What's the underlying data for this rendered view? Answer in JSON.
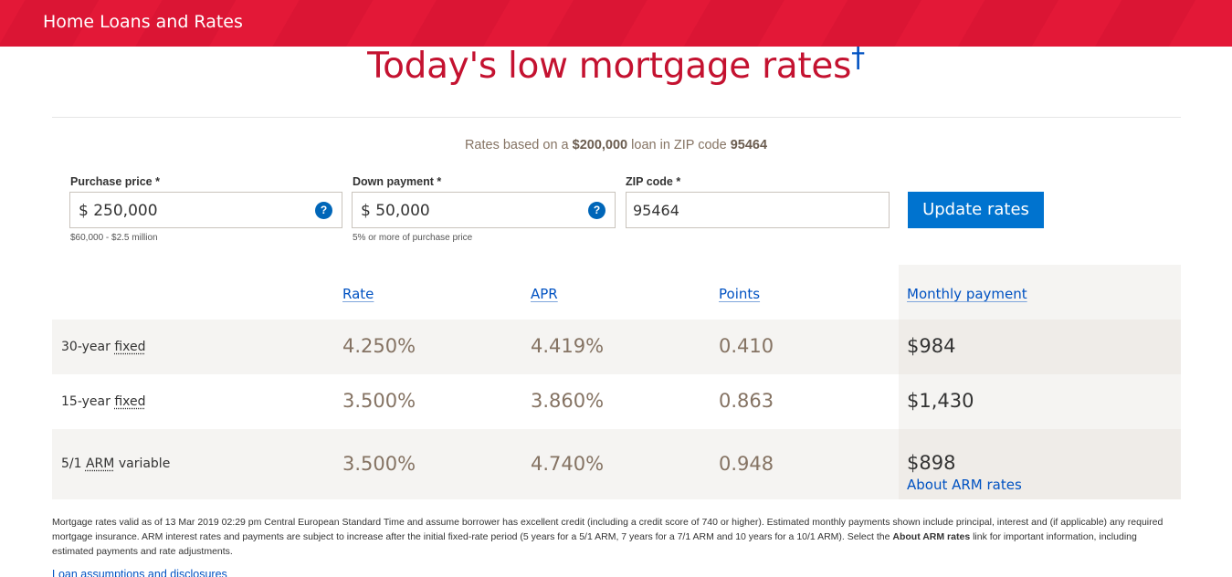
{
  "header": {
    "title": "Home Loans and Rates"
  },
  "hero": {
    "title": "Today's low mortgage rates",
    "dagger": "†"
  },
  "basis": {
    "prefix": "Rates based on a ",
    "loan_amount": "$200,000",
    "middle": " loan in ZIP code ",
    "zip": "95464"
  },
  "form": {
    "purchase_price": {
      "label": "Purchase price *",
      "value": "$ 250,000",
      "hint": "$60,000 - $2.5 million",
      "help": "?"
    },
    "down_payment": {
      "label": "Down payment *",
      "value": "$ 50,000",
      "hint": "5% or more of purchase price",
      "help": "?"
    },
    "zip_code": {
      "label": "ZIP code *",
      "value": "95464"
    },
    "update_label": "Update rates"
  },
  "table": {
    "headers": {
      "rate": "Rate",
      "apr": "APR",
      "points": "Points",
      "monthly": "Monthly payment"
    },
    "rows": [
      {
        "term_prefix": "30-year ",
        "term_link": "fixed",
        "term_suffix": "",
        "rate": "4.250%",
        "apr": "4.419%",
        "points": "0.410",
        "payment": "$984"
      },
      {
        "term_prefix": "15-year ",
        "term_link": "fixed",
        "term_suffix": "",
        "rate": "3.500%",
        "apr": "3.860%",
        "points": "0.863",
        "payment": "$1,430"
      },
      {
        "term_prefix": "5/1 ",
        "term_link": "ARM",
        "term_suffix": " variable",
        "rate": "3.500%",
        "apr": "4.740%",
        "points": "0.948",
        "payment": "$898",
        "extra_link": "About ARM rates"
      }
    ]
  },
  "disclaimer": {
    "text_a": "Mortgage rates valid as of 13 Mar 2019 02:29 pm Central European Standard Time and assume borrower has excellent credit (including a credit score of 740 or higher). Estimated monthly payments shown include principal, interest and (if applicable) any required mortgage insurance. ARM interest rates and payments are subject to increase after the initial fixed-rate period (5 years for a 5/1 ARM, 7 years for a 7/1 ARM and 10 years for a 10/1 ARM). Select the ",
    "bold": "About ARM rates",
    "text_b": " link for important information, including estimated payments and rate adjustments."
  },
  "footer_link": "Loan assumptions and disclosures",
  "colors": {
    "brand_red": "#e31837",
    "title_red": "#c41230",
    "link_blue": "#0052c2",
    "button_blue": "#0073cf",
    "muted_brown": "#857363"
  }
}
